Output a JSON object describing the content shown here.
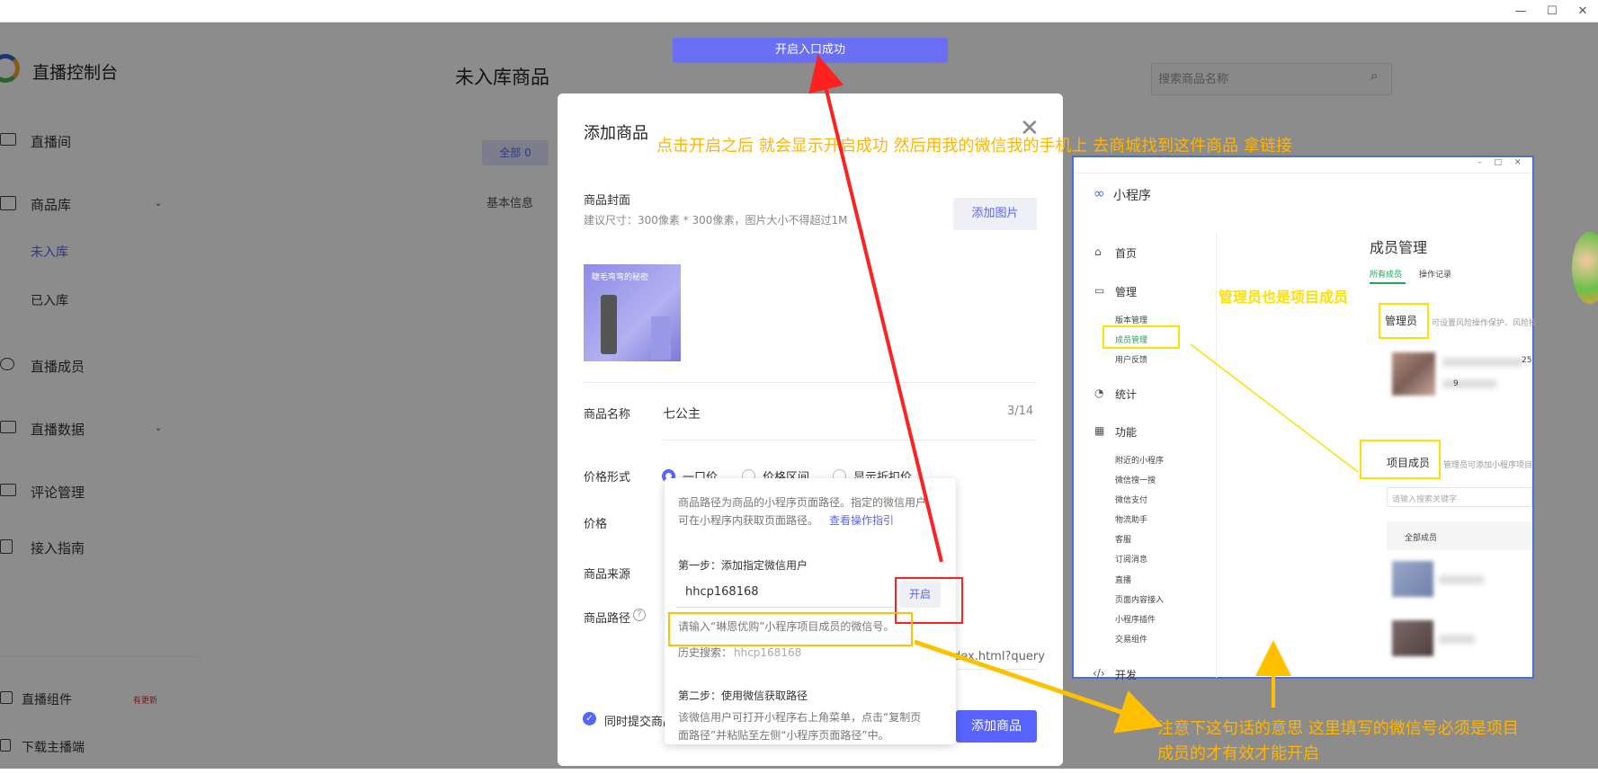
{
  "window": {
    "minimize": "—",
    "maximize": "☐",
    "close": "✕"
  },
  "sidebar": {
    "brand": "直播控制台",
    "items": [
      {
        "label": "直播间",
        "icon": "camera-icon"
      },
      {
        "label": "商品库",
        "icon": "bag-icon"
      },
      {
        "label": "直播成员",
        "icon": "user-icon"
      },
      {
        "label": "直播数据",
        "icon": "chart-icon"
      },
      {
        "label": "评论管理",
        "icon": "comment-icon"
      },
      {
        "label": "接入指南",
        "icon": "book-icon"
      }
    ],
    "sub_items": [
      "未入库",
      "已入库"
    ],
    "bottom": [
      {
        "label": "直播组件",
        "badge": "有更新"
      },
      {
        "label": "下载主播端"
      }
    ]
  },
  "main": {
    "title": "未入库商品",
    "search_placeholder": "搜索商品名称",
    "tab_all": "全部 0",
    "col_base": "基本信息"
  },
  "toast": "开启入口成功",
  "dialog": {
    "title": "添加商品",
    "cover_label": "商品封面",
    "cover_hint": "建议尺寸：300像素 * 300像素，图片大小不得超过1M",
    "add_image": "添加图片",
    "cover_caption": "睫毛弯弯的秘密",
    "name_label": "商品名称",
    "name_value": "七公主",
    "name_count": "3/14",
    "price_form_label": "价格形式",
    "price_options": [
      "一口价",
      "价格区间",
      "显示折扣价"
    ],
    "price_label": "价格",
    "source_label": "商品来源",
    "path_label": "商品路径",
    "path_tail": "dex.html?query",
    "sync_label": "同时提交商品",
    "submit": "添加商品"
  },
  "popover": {
    "desc_1": "商品路径为商品的小程序页面路径。指定的微信用户",
    "desc_2": "可在小程序内获取页面路径。",
    "guide_link": "查看操作指引",
    "step1": "第一步：添加指定微信用户",
    "input_value": "hhcp168168",
    "enable_button": "开启",
    "input_hint": "请输入“琳恩优购”小程序项目成员的微信号。",
    "history": "历史搜索：",
    "history_value": "hhcp168168",
    "step2": "第二步：使用微信获取路径",
    "step2_desc_1": "该微信用户可打开小程序右上角菜单，点击“复制页",
    "step2_desc_2": "面路径”并粘贴至左侧“小程序页面路径”中。"
  },
  "annotations": {
    "top": "点击开启之后 就会显示开启成功 然后用我的微信我的手机上 去商城找到这件商品 拿链接",
    "admin_note": "管理员也是项目成员",
    "bottom_1": "注意下这句话的意思  这里填写的微信号必须是项目",
    "bottom_2": "成员的才有效才能开启",
    "colors": {
      "orange": "#ffb400",
      "red": "#ff2020",
      "yellow": "#ffe000"
    }
  },
  "inset": {
    "app": "小程序",
    "page_title": "成员管理",
    "nav": [
      "首页",
      "管理",
      "统计",
      "功能",
      "开发"
    ],
    "manage_sub": [
      "版本管理",
      "成员管理",
      "用户反馈"
    ],
    "func_sub": [
      "附近的小程序",
      "微信搜一搜",
      "微信支付",
      "物流助手",
      "客服",
      "订阅消息",
      "直播",
      "页面内容接入",
      "小程序插件",
      "交易组件"
    ],
    "tabs": [
      "所有成员",
      "操作记录"
    ],
    "admin_label": "管理员",
    "admin_desc": "可设置风险操作保护、风险操",
    "project_label": "项目成员",
    "project_desc": "管理员可添加小程序项目",
    "search_ph": "请输入搜索关键字",
    "all_members": "全部成员",
    "date_digits": "25",
    "digits2": "9"
  }
}
